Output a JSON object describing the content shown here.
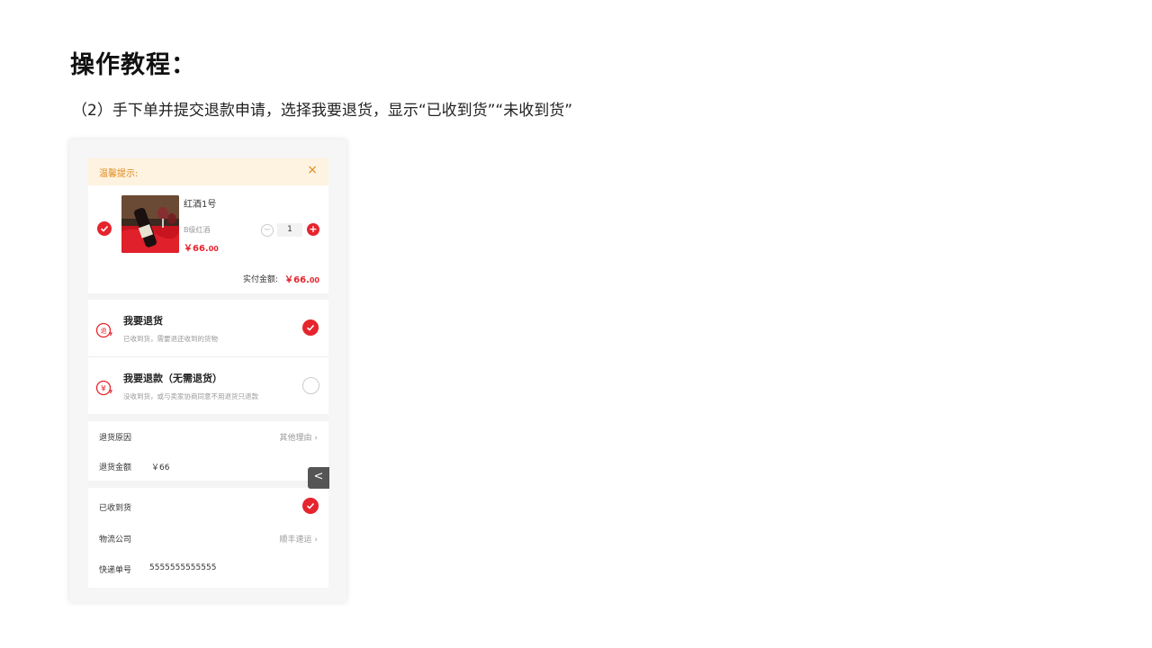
{
  "header": {
    "title": "操作教程：",
    "subtitle": "（2）手下单并提交退款申请，选择我要退货，显示“已收到货”“未收到货”"
  },
  "notice": {
    "text": "温馨提示:",
    "close": "×"
  },
  "product": {
    "name": "红酒1号",
    "spec": "B级红酒",
    "price_main": "￥66.",
    "price_cents": "00",
    "quantity": "1",
    "minus": "−",
    "plus": "+"
  },
  "total": {
    "label": "实付金额:",
    "value_main": "￥66.",
    "value_cents": "00"
  },
  "options": [
    {
      "title": "我要退货",
      "desc": "已收到货，需要退还收到的货物",
      "selected": true,
      "icon": "return-goods-icon"
    },
    {
      "title": "我要退款（无需退货）",
      "desc": "没收到货，或与卖家协商同意不用退货只退款",
      "selected": false,
      "icon": "refund-yuan-icon"
    }
  ],
  "form": {
    "reason_label": "退货原因",
    "reason_value": "其他理由 ›",
    "amount_label": "退货金额",
    "amount_value": "￥66",
    "received_label": "已收到货",
    "logistics_label": "物流公司",
    "logistics_value": "顺丰速运 ›",
    "tracking_label": "快递单号",
    "tracking_value": "5555555555555"
  },
  "side_tab": "<",
  "colors": {
    "accent": "#e5242d",
    "notice_bg": "#fdf3e0",
    "notice_text": "#e08a1f"
  }
}
